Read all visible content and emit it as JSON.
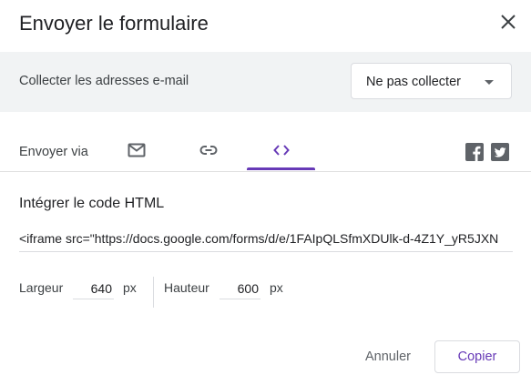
{
  "dialog": {
    "title": "Envoyer le formulaire",
    "close_icon": "close-icon"
  },
  "collect": {
    "label": "Collecter les adresses e-mail",
    "selected": "Ne pas collecter"
  },
  "send": {
    "label": "Envoyer via",
    "tabs": [
      {
        "icon": "email-icon",
        "selected": false
      },
      {
        "icon": "link-icon",
        "selected": false
      },
      {
        "icon": "embed-code-icon",
        "selected": true
      }
    ],
    "social": [
      {
        "icon": "facebook-icon"
      },
      {
        "icon": "twitter-icon"
      }
    ]
  },
  "embed": {
    "title": "Intégrer le code HTML",
    "code": "<iframe src=\"https://docs.google.com/forms/d/e/1FAIpQLSfmXDUlk-d-4Z1Y_yR5JXN"
  },
  "dimensions": {
    "width_label": "Largeur",
    "width_value": "640",
    "height_label": "Hauteur",
    "height_value": "600",
    "unit": "px"
  },
  "actions": {
    "cancel": "Annuler",
    "copy": "Copier"
  },
  "colors": {
    "accent": "#673ab7",
    "bar_bg": "#f1f3f4"
  }
}
